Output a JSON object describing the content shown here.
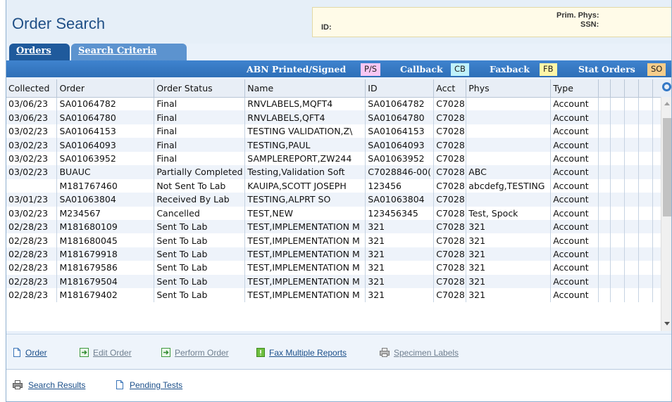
{
  "header": {
    "title": "Order Search",
    "id_label": "ID:",
    "prim_phys_label": "Prim. Phys:",
    "ssn_label": "SSN:"
  },
  "tabs": [
    {
      "label": "Orders",
      "active": true
    },
    {
      "label": "Search Criteria",
      "active": false
    }
  ],
  "legend": {
    "abn_label": "ABN Printed/Signed",
    "abn_key": "P/S",
    "abn_color": "#f8c7f3",
    "callback_label": "Callback",
    "callback_key": "CB",
    "callback_color": "#bff1fb",
    "faxback_label": "Faxback",
    "faxback_key": "FB",
    "faxback_color": "#fff6a8",
    "stat_label": "Stat Orders",
    "stat_key": "SO",
    "stat_color": "#f6cd8b"
  },
  "table": {
    "columns": [
      "Collected",
      "Order",
      "Order Status",
      "Name",
      "ID",
      "Acct",
      "Phys",
      "Type",
      "",
      "",
      "",
      "",
      ""
    ],
    "rows": [
      [
        "03/06/23",
        "SA01064782",
        "Final",
        "RNVLABELS,MQFT4",
        "SA01064782",
        "C7028",
        "",
        "Account"
      ],
      [
        "03/06/23",
        "SA01064780",
        "Final",
        "RNVLABELS,QFT4",
        "SA01064780",
        "C7028",
        "",
        "Account"
      ],
      [
        "03/02/23",
        "SA01064153",
        "Final",
        "TESTING VALIDATION,Z\\",
        "SA01064153",
        "C7028",
        "",
        "Account"
      ],
      [
        "03/02/23",
        "SA01064093",
        "Final",
        "TESTING,PAUL",
        "SA01064093",
        "C7028",
        "",
        "Account"
      ],
      [
        "03/02/23",
        "SA01063952",
        "Final",
        "SAMPLEREPORT,ZW244",
        "SA01063952",
        "C7028",
        "",
        "Account"
      ],
      [
        "03/02/23",
        "BUAUC",
        "Partially Completed",
        "Testing,Validation Soft",
        "C7028846-00(",
        "C7028",
        "ABC",
        "Account"
      ],
      [
        "",
        "M181767460",
        "Not Sent To Lab",
        "KAUIPA,SCOTT JOSEPH",
        "123456",
        "C7028",
        "abcdefg,TESTING",
        "Account"
      ],
      [
        "03/01/23",
        "SA01063804",
        "Received By Lab",
        "TESTING,ALPRT SO",
        "SA01063804",
        "C7028",
        "",
        "Account"
      ],
      [
        "03/02/23",
        "M234567",
        "Cancelled",
        "TEST,NEW",
        "123456345",
        "C7028",
        "Test, Spock",
        "Account"
      ],
      [
        "02/28/23",
        "M181680109",
        "Sent To Lab",
        "TEST,IMPLEMENTATION M",
        "321",
        "C7028",
        "321",
        "Account"
      ],
      [
        "02/28/23",
        "M181680045",
        "Sent To Lab",
        "TEST,IMPLEMENTATION M",
        "321",
        "C7028",
        "321",
        "Account"
      ],
      [
        "02/28/23",
        "M181679918",
        "Sent To Lab",
        "TEST,IMPLEMENTATION M",
        "321",
        "C7028",
        "321",
        "Account"
      ],
      [
        "02/28/23",
        "M181679586",
        "Sent To Lab",
        "TEST,IMPLEMENTATION M",
        "321",
        "C7028",
        "321",
        "Account"
      ],
      [
        "02/28/23",
        "M181679504",
        "Sent To Lab",
        "TEST,IMPLEMENTATION M",
        "321",
        "C7028",
        "321",
        "Account"
      ],
      [
        "02/28/23",
        "M181679402",
        "Sent To Lab",
        "TEST,IMPLEMENTATION M",
        "321",
        "C7028",
        "321",
        "Account"
      ]
    ]
  },
  "actions": [
    {
      "label": "Order",
      "icon": "document-icon",
      "enabled": true
    },
    {
      "label": "Edit Order",
      "icon": "arrow-right-box-icon",
      "enabled": false
    },
    {
      "label": "Perform Order",
      "icon": "arrow-right-box-icon",
      "enabled": false
    },
    {
      "label": "Fax Multiple Reports",
      "icon": "fax-icon",
      "enabled": true
    },
    {
      "label": "Specimen Labels",
      "icon": "printer-icon",
      "enabled": false
    }
  ],
  "links": [
    {
      "label": "Search Results",
      "icon": "printer-icon"
    },
    {
      "label": "Pending Tests",
      "icon": "document-icon"
    }
  ]
}
